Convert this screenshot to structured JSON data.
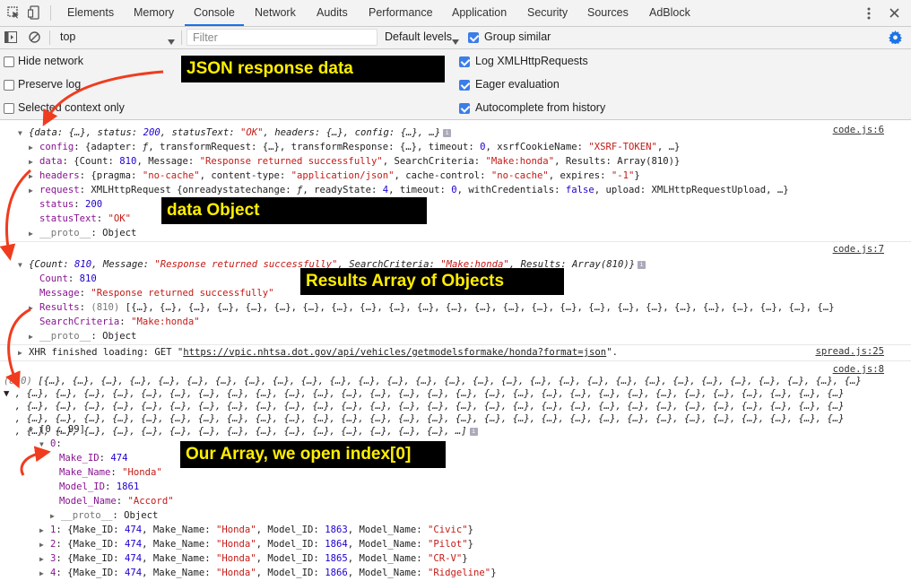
{
  "tabs": [
    "Elements",
    "Memory",
    "Console",
    "Network",
    "Audits",
    "Performance",
    "Application",
    "Security",
    "Sources",
    "AdBlock"
  ],
  "active_tab": "Console",
  "toolbar": {
    "context": "top",
    "filter_placeholder": "Filter",
    "levels": "Default levels",
    "group_similar": "Group similar"
  },
  "settings": {
    "hide_network": "Hide network",
    "preserve_log": "Preserve log",
    "selected_context": "Selected context only",
    "log_xhr": "Log XMLHttpRequests",
    "eager_eval": "Eager evaluation",
    "autocomplete": "Autocomplete from history"
  },
  "sources": {
    "a": "code.js:6",
    "b": "code.js:7",
    "c": "spread.js:25",
    "d": "code.js:8"
  },
  "annotations": {
    "json_response": "JSON  response data",
    "data_object": "data Object",
    "results_array": "Results Array of Objects",
    "our_array": "Our Array, we open index[0]"
  },
  "icons": [
    "more-vert-icon",
    "close-icon",
    "inspect-icon",
    "device-icon",
    "sidebar-icon",
    "clear-icon",
    "gear-icon",
    "dropdown-icon",
    "info-icon"
  ],
  "colors": {
    "accent": "#1a73e8",
    "annotation_bg": "#000000",
    "annotation_text": "#ffee00",
    "arrow": "#f03c1e"
  }
}
